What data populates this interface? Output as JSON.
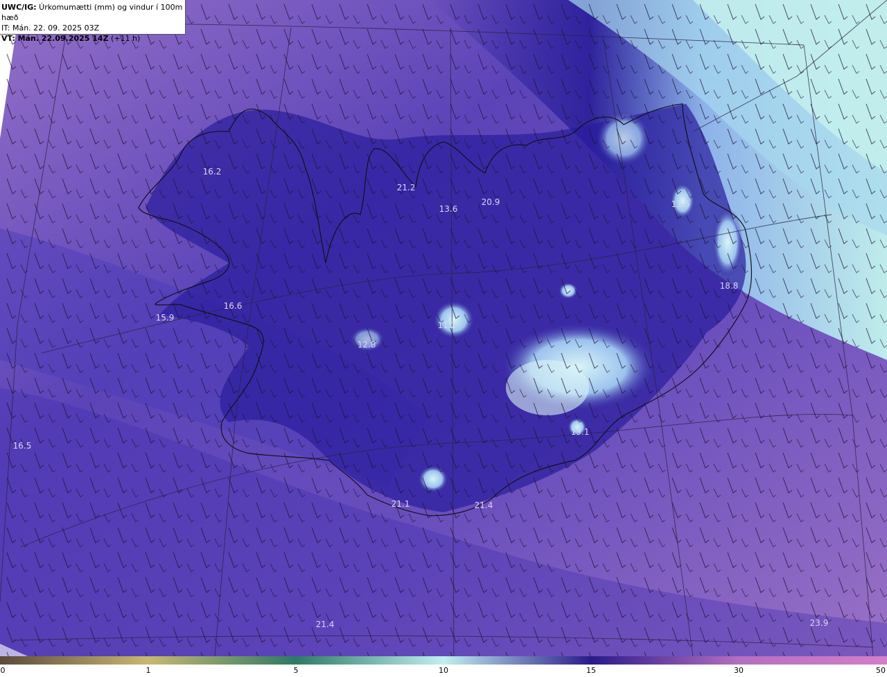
{
  "header": {
    "line1_bold": "UWC/IG:",
    "line1_rest": " Úrkomumætti (mm) og vindur í 100m hæð",
    "line2": "IT: Mán. 22. 09. 2025 03Z",
    "line3_bold": "VT: Mán. 22.09.2025 14Z",
    "line3_rest": " (+11 h)"
  },
  "values": [
    {
      "text": "16.2"
    },
    {
      "text": "21.2"
    },
    {
      "text": "13.6"
    },
    {
      "text": "20.9"
    },
    {
      "text": "11.5"
    },
    {
      "text": "18.8"
    },
    {
      "text": "16.6"
    },
    {
      "text": "15.9"
    },
    {
      "text": "12.8"
    },
    {
      "text": "11.2"
    },
    {
      "text": "16.5"
    },
    {
      "text": "13.1"
    },
    {
      "text": "21.1"
    },
    {
      "text": "21.4"
    },
    {
      "text": "21.4"
    },
    {
      "text": "23.9"
    }
  ],
  "colorbar": {
    "ticks": [
      "0",
      "1",
      "5",
      "10",
      "15",
      "30",
      "50"
    ],
    "colors": [
      "#5a4a3a",
      "#c8b870",
      "#2e7a64",
      "#bff0ee",
      "#2a1a8a",
      "#b46fc0",
      "#d37fc8"
    ]
  }
}
